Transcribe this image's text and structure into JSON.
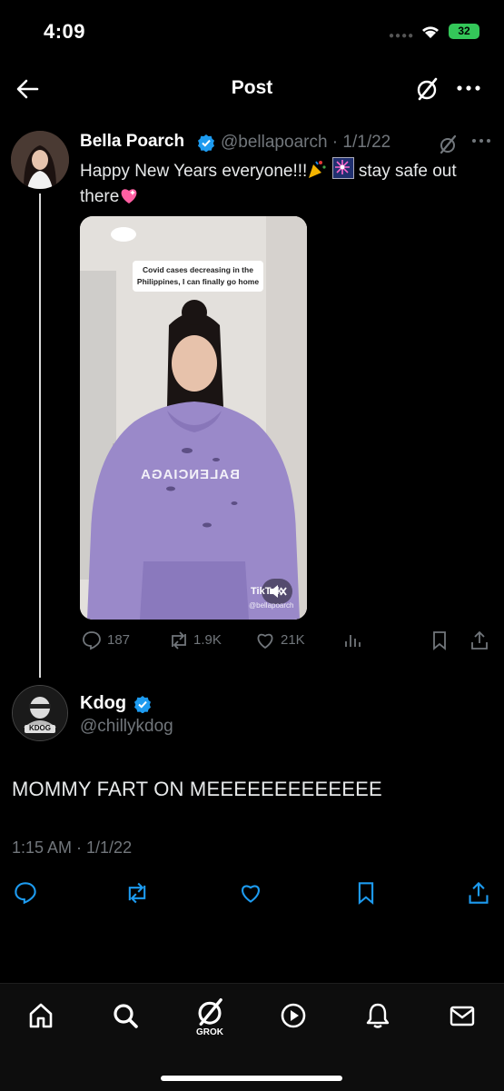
{
  "status_bar": {
    "time": "4:09",
    "battery": "32"
  },
  "nav": {
    "title": "Post"
  },
  "quoted_post": {
    "author_name": "Bella Poarch",
    "handle_date": "@bellapoarch · 1/1/22",
    "text_part1": "Happy New Years everyone!!!",
    "text_part2": " stay safe out there",
    "media": {
      "caption": "Covid cases decreasing in the Philippines, I can finally go home",
      "watermark": "TikTok",
      "watermark_handle": "@bellapoarch",
      "hoodie_text": "BALENCIAGA"
    },
    "stats": {
      "replies": "187",
      "reposts": "1.9K",
      "likes": "21K"
    }
  },
  "main_post": {
    "author_name": "Kdog",
    "handle": "@chillykdog",
    "avatar_text": "KDOG",
    "text": "MOMMY FART ON MEEEEEEEEEEEEE",
    "timestamp": "1:15 AM · 1/1/22"
  },
  "tabbar": {
    "grok_label": "GROK"
  },
  "colors": {
    "accent": "#1d9bf0",
    "muted": "#71767b",
    "battery": "#34c759",
    "hoodie": "#9a89c9"
  }
}
